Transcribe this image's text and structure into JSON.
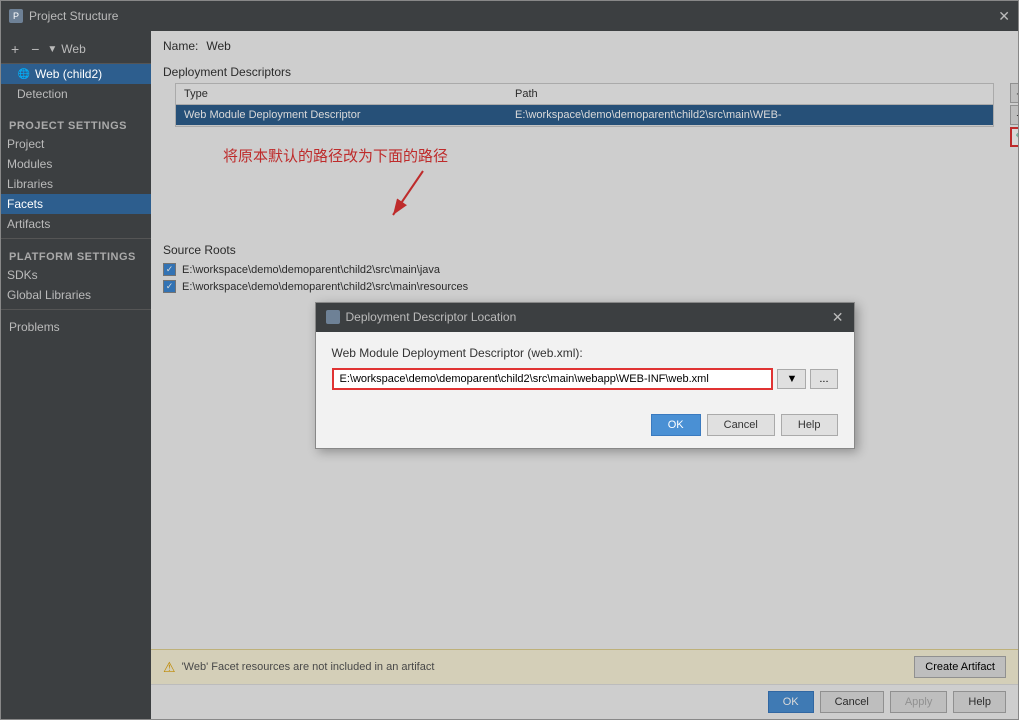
{
  "window": {
    "title": "Project Structure",
    "icon": "P"
  },
  "sidebar": {
    "toolbar": {
      "add_btn": "+",
      "remove_btn": "−"
    },
    "tree": {
      "web_label": "Web",
      "web_child_label": "Web (child2)"
    },
    "project_settings_label": "Project Settings",
    "items": [
      {
        "id": "project",
        "label": "Project"
      },
      {
        "id": "modules",
        "label": "Modules"
      },
      {
        "id": "libraries",
        "label": "Libraries"
      },
      {
        "id": "facets",
        "label": "Facets",
        "selected": true
      },
      {
        "id": "artifacts",
        "label": "Artifacts"
      }
    ],
    "platform_settings_label": "Platform Settings",
    "platform_items": [
      {
        "id": "sdks",
        "label": "SDKs"
      },
      {
        "id": "global-libraries",
        "label": "Global Libraries"
      }
    ],
    "problems_label": "Problems"
  },
  "content": {
    "name_label": "Name:",
    "name_value": "Web",
    "deployment_descriptors_title": "Deployment Descriptors",
    "table": {
      "columns": [
        "Type",
        "Path"
      ],
      "rows": [
        {
          "type": "Web Module Deployment Descriptor",
          "path": "E:\\workspace\\demo\\demoparent\\child2\\src\\main\\WEB-",
          "selected": true
        }
      ]
    },
    "annotation_text": "将原本默认的路径改为下面的路径",
    "source_roots_title": "Source Roots",
    "source_roots": [
      {
        "path": "E:\\workspace\\demo\\demoparent\\child2\\src\\main\\java",
        "checked": true
      },
      {
        "path": "E:\\workspace\\demo\\demoparent\\child2\\src\\main\\resources",
        "checked": true
      }
    ],
    "warning_text": "'Web' Facet resources are not included in an artifact",
    "create_artifact_btn": "Create Artifact"
  },
  "bottom_buttons": {
    "ok_label": "OK",
    "cancel_label": "Cancel",
    "apply_label": "Apply",
    "help_label": "Help"
  },
  "dialog": {
    "title": "Deployment Descriptor Location",
    "icon": "D",
    "label": "Web Module Deployment Descriptor (web.xml):",
    "input_value": "E:\\workspace\\demo\\demoparent\\child2\\src\\main\\webapp\\WEB-INF\\web.xml",
    "dropdown_btn": "▼",
    "browse_btn": "...",
    "ok_btn": "OK",
    "cancel_btn": "Cancel",
    "help_btn": "Help"
  },
  "detection_label": "Detection"
}
